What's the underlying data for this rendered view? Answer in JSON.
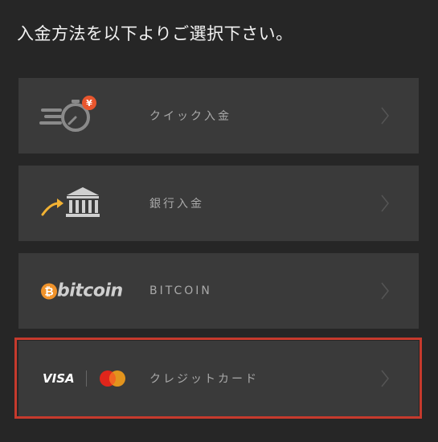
{
  "header": {
    "title": "入金方法を以下よりご選択下さい。"
  },
  "methods": [
    {
      "label": "クイック入金",
      "icon": "quick-deposit-timer-yen-icon"
    },
    {
      "label": "銀行入金",
      "icon": "bank-arrow-icon"
    },
    {
      "label": "BITCOIN",
      "icon": "bitcoin-logo",
      "logo_text": "bitcoin"
    },
    {
      "label": "クレジットカード",
      "icon": "visa-mastercard-logo",
      "logo_text": "VISA"
    }
  ],
  "colors": {
    "background": "#262626",
    "card": "#3a3a3a",
    "label": "#a9a9a9",
    "highlight": "#c63a2d",
    "accent_orange": "#f0812b",
    "accent_yellow": "#f2b233"
  }
}
